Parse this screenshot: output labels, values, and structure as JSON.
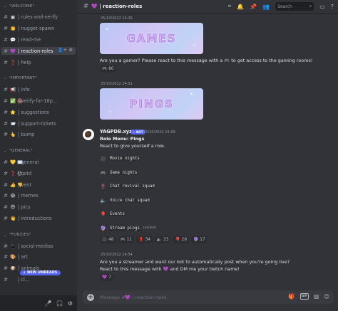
{
  "sidebar": {
    "rows": [
      {
        "type": "category",
        "label": "°WELCOME°",
        "top": 0
      },
      {
        "type": "channel",
        "prefix": "▣",
        "label": "| rules-and-verify"
      },
      {
        "type": "channel",
        "prefix": "👏",
        "label": "| nugget-spawn"
      },
      {
        "type": "channel",
        "prefix": "💬",
        "label": "| read-me"
      },
      {
        "type": "channel",
        "prefix": "💜",
        "label": "| reaction-roles",
        "selected": true
      },
      {
        "type": "channel",
        "prefix": "❓",
        "label": "| help"
      },
      {
        "type": "category",
        "label": "°IMPORTANT°"
      },
      {
        "type": "channel",
        "prefix": "📢",
        "label": "| info"
      },
      {
        "type": "channel",
        "prefix": "✅ 🔞",
        "label": "| verify-for-18p..."
      },
      {
        "type": "channel",
        "prefix": "⭐",
        "label": "| suggestions"
      },
      {
        "type": "channel",
        "prefix": "📨",
        "label": "| support-tickets"
      },
      {
        "type": "channel",
        "prefix": "👆",
        "label": "| bump"
      },
      {
        "type": "category",
        "label": "°GENERAL°"
      },
      {
        "type": "channel",
        "prefix": "💛 ✉️",
        "label": "| general"
      },
      {
        "type": "channel",
        "prefix": "❓ 😐",
        "label": "| qotd"
      },
      {
        "type": "channel",
        "prefix": "👍 👎",
        "label": "| vent"
      },
      {
        "type": "channel",
        "prefix": "😂",
        "label": "| memes"
      },
      {
        "type": "channel",
        "prefix": "😎",
        "label": "| pics"
      },
      {
        "type": "channel",
        "prefix": "👋",
        "label": "| introductions"
      },
      {
        "type": "category",
        "label": "°FUNZIES°"
      },
      {
        "type": "channel",
        "prefix": "📱",
        "label": "| social-medias"
      },
      {
        "type": "channel",
        "prefix": "🎨",
        "label": "| art"
      },
      {
        "type": "channel",
        "prefix": "🐶",
        "label": "| animals"
      },
      {
        "type": "channel",
        "prefix": "",
        "label": "| cl..."
      }
    ],
    "new_unreads": "NEW UNREADS"
  },
  "topbar": {
    "channel_title": "💜 | reaction-roles",
    "search_placeholder": "Search"
  },
  "messages": {
    "ts1": "25/10/2022 14:35",
    "banner1": "GAMES",
    "msg1": "Are you a gamer? Please react to this message with a 🎮 to get access to the gaming rooms!",
    "rxn1": {
      "emoji": "🎮",
      "count": "80"
    },
    "ts2": "25/10/2022 14:51",
    "banner2": "PINGS",
    "bot": {
      "name": "YAGPDB.xyz",
      "badge": "✓ BOT",
      "timestamp": "25/10/2022 15:09",
      "menu_title": "Role Menu: Pings",
      "intro": "React to give yourself a role.",
      "items": [
        {
          "icon": "🎥",
          "label": "Movie nights"
        },
        {
          "icon": "🎮",
          "label": "Game nights"
        },
        {
          "icon": "‼️",
          "label": "Chat revival squad"
        },
        {
          "icon": "🔈",
          "label": "Voice chat squad"
        },
        {
          "icon": "🎈",
          "label": "Events"
        },
        {
          "icon": "🔮",
          "label": "Stream pings",
          "edited": "(edited)"
        }
      ],
      "reactions": [
        {
          "emoji": "🎥",
          "count": "48"
        },
        {
          "emoji": "🎮",
          "count": "11"
        },
        {
          "emoji": "‼️",
          "count": "34"
        },
        {
          "emoji": "🔈",
          "count": "33"
        },
        {
          "emoji": "🎈",
          "count": "28"
        },
        {
          "emoji": "🔮",
          "count": "17"
        }
      ]
    },
    "ts3": "25/10/2022 14:54",
    "msg3a": "Are you a streamer and want our bot to automatically post when you're going live?",
    "msg3b": "React to this message with 💜 and DM me your twitch name!",
    "rxn3": {
      "emoji": "💜",
      "count": "7"
    }
  },
  "composer": {
    "placeholder": "Message #💜 | reaction-roles"
  }
}
